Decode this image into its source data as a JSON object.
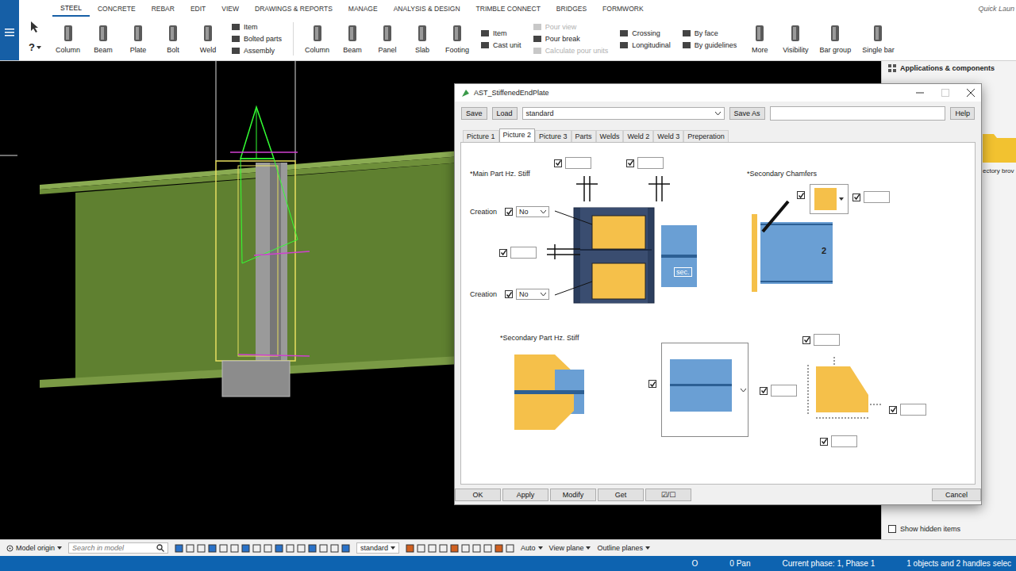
{
  "ribbon": {
    "tabs": [
      {
        "label": "STEEL",
        "selected": true
      },
      {
        "label": "CONCRETE",
        "selected": false
      },
      {
        "label": "REBAR",
        "selected": false
      },
      {
        "label": "EDIT",
        "selected": false
      },
      {
        "label": "VIEW",
        "selected": false
      },
      {
        "label": "DRAWINGS & REPORTS",
        "selected": false
      },
      {
        "label": "MANAGE",
        "selected": false
      },
      {
        "label": "ANALYSIS & DESIGN",
        "selected": false
      },
      {
        "label": "TRIMBLE CONNECT",
        "selected": false
      },
      {
        "label": "BRIDGES",
        "selected": false
      },
      {
        "label": "FORMWORK",
        "selected": false
      }
    ],
    "quick_launch": "Quick Laun",
    "help_glyph": "?",
    "tools": [
      {
        "kind": "big",
        "label": "Column"
      },
      {
        "kind": "big",
        "label": "Beam"
      },
      {
        "kind": "big",
        "label": "Plate"
      },
      {
        "kind": "big",
        "label": "Bolt"
      },
      {
        "kind": "big",
        "label": "Weld"
      },
      {
        "kind": "stack",
        "items": [
          {
            "label": "Item",
            "disabled": false
          },
          {
            "label": "Bolted parts",
            "disabled": false
          },
          {
            "label": "Assembly",
            "disabled": false
          }
        ]
      },
      {
        "kind": "separator"
      },
      {
        "kind": "big",
        "label": "Column"
      },
      {
        "kind": "big",
        "label": "Beam"
      },
      {
        "kind": "big",
        "label": "Panel"
      },
      {
        "kind": "big",
        "label": "Slab"
      },
      {
        "kind": "big",
        "label": "Footing"
      },
      {
        "kind": "stack",
        "items": [
          {
            "label": "Item",
            "disabled": false
          },
          {
            "label": "Cast unit",
            "disabled": false
          }
        ]
      },
      {
        "kind": "stack",
        "items": [
          {
            "label": "Pour view",
            "disabled": true
          },
          {
            "label": "Pour break",
            "disabled": false
          },
          {
            "label": "Calculate pour units",
            "disabled": true
          }
        ]
      },
      {
        "kind": "stack",
        "items": [
          {
            "label": "Crossing",
            "disabled": false
          },
          {
            "label": "Longitudinal",
            "disabled": false
          }
        ]
      },
      {
        "kind": "stack",
        "items": [
          {
            "label": "By face",
            "disabled": false
          },
          {
            "label": "By guidelines",
            "disabled": false
          }
        ]
      },
      {
        "kind": "big",
        "label": "More"
      },
      {
        "kind": "big",
        "label": "Visibility"
      },
      {
        "kind": "big",
        "label": "Bar group"
      },
      {
        "kind": "big",
        "label": "Single bar"
      }
    ]
  },
  "side_panel": {
    "title": "Applications & components",
    "folder_label": "ectory brov",
    "show_hidden": {
      "label": "Show hidden items",
      "checked": false
    }
  },
  "dialog": {
    "title": "AST_StiffenedEndPlate",
    "save": "Save",
    "load": "Load",
    "preset": "standard",
    "save_as": "Save As",
    "save_as_value": "",
    "help": "Help",
    "tabs": [
      {
        "label": "Picture 1",
        "selected": false
      },
      {
        "label": "Picture 2",
        "selected": true
      },
      {
        "label": "Picture 3",
        "selected": false
      },
      {
        "label": "Parts",
        "selected": false
      },
      {
        "label": "Welds",
        "selected": false
      },
      {
        "label": "Weld 2",
        "selected": false
      },
      {
        "label": "Weld 3",
        "selected": false
      },
      {
        "label": "Preperation",
        "selected": false
      }
    ],
    "sections": [
      "*Main Part Hz. Stiff",
      "*Secondary Chamfers",
      "*Secondary Part Hz. Stiff"
    ],
    "part_label": "sec.",
    "chamfer_part_label": "2",
    "controls": [
      {
        "kind": "check-field",
        "checked": true,
        "value": ""
      },
      {
        "kind": "check-field",
        "checked": true,
        "value": ""
      },
      {
        "kind": "check-select",
        "label": "Creation",
        "checked": true,
        "value": "No"
      },
      {
        "kind": "check-field",
        "checked": true,
        "value": ""
      },
      {
        "kind": "check-select",
        "label": "Creation",
        "checked": true,
        "value": "No"
      },
      {
        "kind": "checkbox",
        "checked": true
      },
      {
        "kind": "check-field",
        "checked": true,
        "value": ""
      },
      {
        "kind": "checkbox",
        "checked": true
      },
      {
        "kind": "check-field",
        "checked": true,
        "value": ""
      },
      {
        "kind": "check-field",
        "checked": true,
        "value": ""
      },
      {
        "kind": "check-field",
        "checked": true,
        "value": ""
      },
      {
        "kind": "check-field",
        "checked": true,
        "value": ""
      }
    ],
    "footer_buttons": [
      {
        "label": "OK"
      },
      {
        "label": "Apply"
      },
      {
        "label": "Modify"
      },
      {
        "label": "Get"
      },
      {
        "label": "☑/☐"
      }
    ],
    "cancel": "Cancel"
  },
  "bottom_toolbar": {
    "origin": "Model origin",
    "search_placeholder": "Search in model",
    "filter": "standard",
    "snap": "Auto",
    "view_plane": "View plane",
    "outline": "Outline planes"
  },
  "status_bar": {
    "items": [
      "O",
      "0 Pan",
      "Current phase: 1, Phase 1",
      "1 objects and 2 handles selec"
    ]
  }
}
